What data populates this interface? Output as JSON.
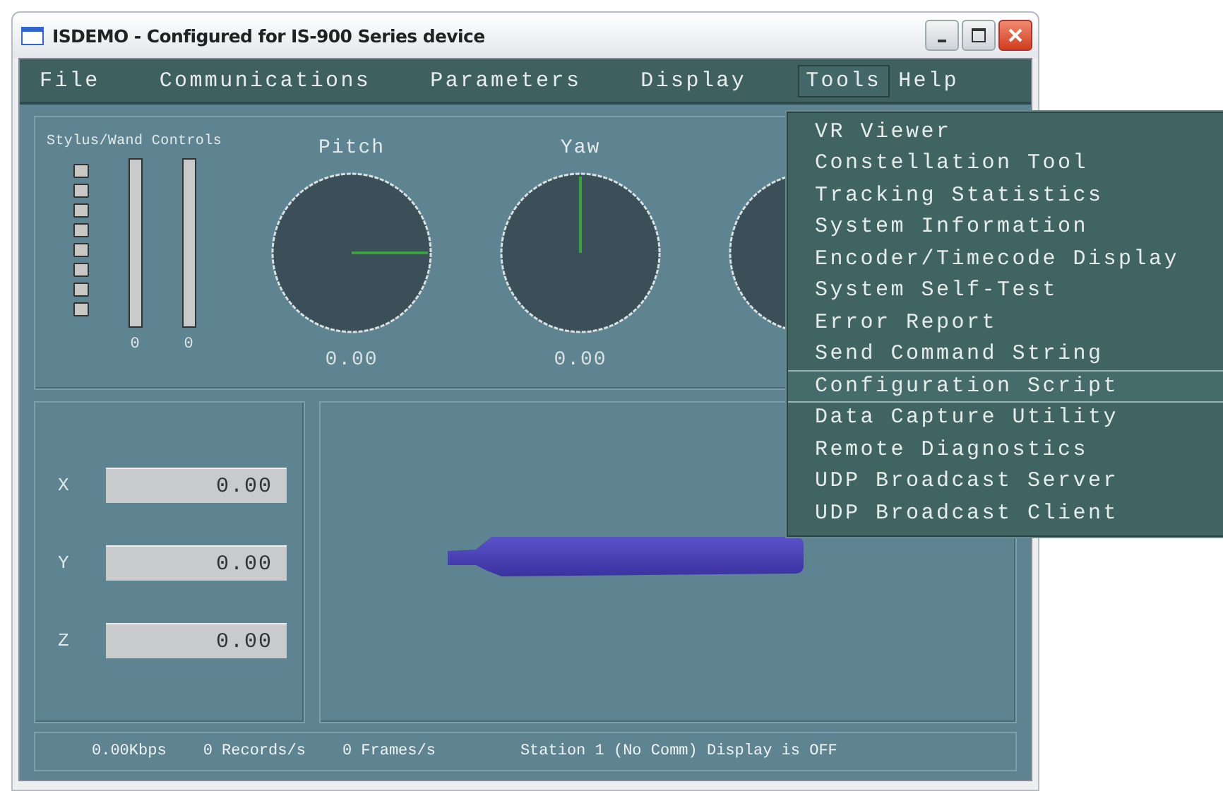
{
  "window": {
    "title": "ISDEMO - Configured for IS-900 Series device"
  },
  "menu_bar": [
    {
      "label": "File",
      "selected": false
    },
    {
      "label": "Communications",
      "selected": false
    },
    {
      "label": "Parameters",
      "selected": false
    },
    {
      "label": "Display",
      "selected": false
    },
    {
      "label": "Tools",
      "selected": true
    },
    {
      "label": "Help",
      "selected": false
    }
  ],
  "tools_menu": [
    {
      "label": "VR Viewer",
      "selected": false
    },
    {
      "label": "Constellation Tool",
      "selected": false
    },
    {
      "label": "Tracking Statistics",
      "selected": false
    },
    {
      "label": "System Information",
      "selected": false
    },
    {
      "label": "Encoder/Timecode Display",
      "selected": false
    },
    {
      "label": "System Self-Test",
      "selected": false
    },
    {
      "label": "Error Report",
      "selected": false
    },
    {
      "label": "Send Command String",
      "selected": false
    },
    {
      "label": "Configuration Script",
      "selected": true
    },
    {
      "label": "Data Capture Utility",
      "selected": false
    },
    {
      "label": "Remote Diagnostics",
      "selected": false
    },
    {
      "label": "UDP Broadcast Server",
      "selected": false
    },
    {
      "label": "UDP Broadcast Client",
      "selected": false
    }
  ],
  "stylus_controls": {
    "title": "Stylus/Wand Controls",
    "sliders": [
      {
        "reading": "0"
      },
      {
        "reading": "0"
      }
    ]
  },
  "dials": [
    {
      "label": "Pitch",
      "reading": "0.00"
    },
    {
      "label": "Yaw",
      "reading": "0.00"
    }
  ],
  "position": [
    {
      "label": "X",
      "value": "0.00"
    },
    {
      "label": "Y",
      "value": "0.00"
    },
    {
      "label": "Z",
      "value": "0.00"
    }
  ],
  "status_bar": [
    "0.00Kbps",
    "0 Records/s",
    "0 Frames/s",
    "Station 1 (No Comm) Display is OFF"
  ]
}
